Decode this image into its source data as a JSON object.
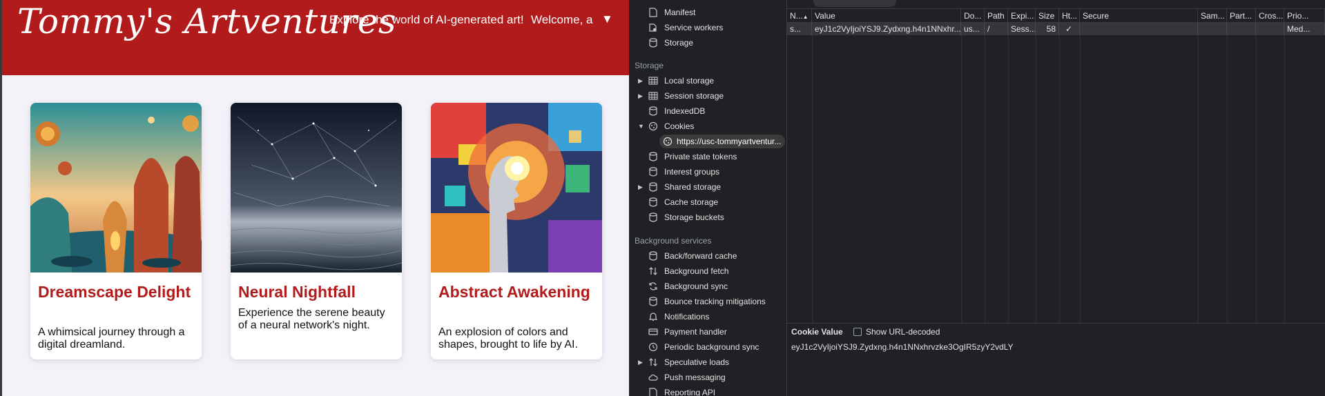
{
  "site": {
    "title": "Tommy's Artventures",
    "tagline": "Explore the world of AI-generated art!",
    "welcome": "Welcome, a",
    "dropdown_caret": "▼",
    "cards": [
      {
        "title": "Dreamscape Delight",
        "description": "A whimsical journey through a digital dreamland.",
        "image": "dreamscape-image"
      },
      {
        "title": "Neural Nightfall",
        "description": "Experience the serene beauty of a neural network's night.",
        "image": "neural-nightfall-image"
      },
      {
        "title": "Abstract Awakening",
        "description": "An explosion of colors and shapes, brought to life by AI.",
        "image": "abstract-awakening-image"
      }
    ]
  },
  "devtools": {
    "sidebar": {
      "app_items": [
        {
          "label": "Manifest",
          "icon": "file-icon"
        },
        {
          "label": "Service workers",
          "icon": "gear-icon"
        },
        {
          "label": "Storage",
          "icon": "database-icon"
        }
      ],
      "storage_header": "Storage",
      "storage_items": [
        {
          "label": "Local storage",
          "icon": "grid-icon",
          "arrow": "▶"
        },
        {
          "label": "Session storage",
          "icon": "grid-icon",
          "arrow": "▶"
        },
        {
          "label": "IndexedDB",
          "icon": "database-icon",
          "arrow": ""
        },
        {
          "label": "Cookies",
          "icon": "cookie-icon",
          "arrow": "▼"
        },
        {
          "label": "https://usc-tommyartventur...",
          "icon": "cookie-icon",
          "arrow": "",
          "selected": true
        },
        {
          "label": "Private state tokens",
          "icon": "database-icon",
          "arrow": ""
        },
        {
          "label": "Interest groups",
          "icon": "database-icon",
          "arrow": ""
        },
        {
          "label": "Shared storage",
          "icon": "database-icon",
          "arrow": "▶"
        },
        {
          "label": "Cache storage",
          "icon": "database-icon",
          "arrow": ""
        },
        {
          "label": "Storage buckets",
          "icon": "database-icon",
          "arrow": ""
        }
      ],
      "background_header": "Background services",
      "background_items": [
        {
          "label": "Back/forward cache",
          "icon": "database-icon",
          "arrow": ""
        },
        {
          "label": "Background fetch",
          "icon": "updown-arrows-icon",
          "arrow": ""
        },
        {
          "label": "Background sync",
          "icon": "sync-icon",
          "arrow": ""
        },
        {
          "label": "Bounce tracking mitigations",
          "icon": "database-icon",
          "arrow": ""
        },
        {
          "label": "Notifications",
          "icon": "bell-icon",
          "arrow": ""
        },
        {
          "label": "Payment handler",
          "icon": "card-icon",
          "arrow": ""
        },
        {
          "label": "Periodic background sync",
          "icon": "clock-icon",
          "arrow": ""
        },
        {
          "label": "Speculative loads",
          "icon": "updown-arrows-icon",
          "arrow": "▶"
        },
        {
          "label": "Push messaging",
          "icon": "cloud-icon",
          "arrow": ""
        },
        {
          "label": "Reporting API",
          "icon": "file-icon",
          "arrow": ""
        }
      ]
    },
    "table": {
      "columns": [
        "N...",
        "Value",
        "Do...",
        "Path",
        "Expi...",
        "Size",
        "Ht...",
        "Secure",
        "Sam...",
        "Part...",
        "Cros...",
        "Prio..."
      ],
      "sort_indicator": "▲",
      "rows": [
        [
          "s...",
          "eyJ1c2VyIjoiYSJ9.Zydxng.h4n1NNxhr...",
          "us...",
          "/",
          "Sess...",
          "58",
          "✓",
          "",
          "",
          "",
          "",
          "Med..."
        ]
      ]
    },
    "cookie_value": {
      "label": "Cookie Value",
      "checkbox_label": "Show URL-decoded",
      "value": "eyJ1c2VyIjoiYSJ9.Zydxng.h4n1NNxhrvzke3OgIR5zyY2vdLY"
    }
  }
}
